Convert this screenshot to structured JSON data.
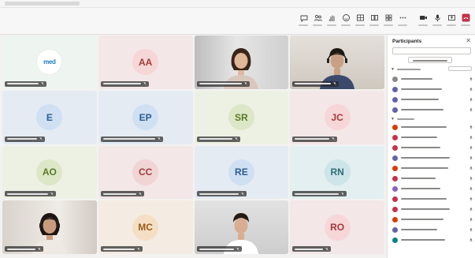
{
  "meeting": {
    "timer": ""
  },
  "toolbar": {
    "tools": [
      {
        "icon": "chat-icon"
      },
      {
        "icon": "people-icon"
      },
      {
        "icon": "raise-hand-icon"
      },
      {
        "icon": "reactions-icon"
      },
      {
        "icon": "view-icon"
      },
      {
        "icon": "rooms-icon"
      },
      {
        "icon": "apps-icon"
      },
      {
        "icon": "more-icon"
      },
      {
        "icon": "camera-icon"
      },
      {
        "icon": "mic-icon"
      },
      {
        "icon": "share-icon"
      }
    ],
    "leave_icon": "phone-hangup-icon"
  },
  "colors": {
    "accent": "#6264a7",
    "leave": "#c4314b",
    "nametag_bg": "#3b3a39"
  },
  "tiles": [
    {
      "kind": "logo",
      "initials": "",
      "logo_text": "med",
      "bg": "#eef4ef"
    },
    {
      "kind": "avatar",
      "initials": "AA",
      "bg": "#f3e7e7",
      "avatar_bg": "#f6d6d6",
      "avatar_fg": "#a33b3b"
    },
    {
      "kind": "video",
      "initials": "",
      "bg": "#cfcfcf"
    },
    {
      "kind": "video",
      "initials": "",
      "bg": "#d9d6d0"
    },
    {
      "kind": "avatar",
      "initials": "E",
      "bg": "#e5ebf3",
      "avatar_bg": "#cfe0f2",
      "avatar_fg": "#2b5c93"
    },
    {
      "kind": "avatar",
      "initials": "EP",
      "bg": "#e5ebf3",
      "avatar_bg": "#cfe0f2",
      "avatar_fg": "#2b5c93"
    },
    {
      "kind": "avatar",
      "initials": "SR",
      "bg": "#edf1e4",
      "avatar_bg": "#dbe7c7",
      "avatar_fg": "#5b7a26"
    },
    {
      "kind": "avatar",
      "initials": "JC",
      "bg": "#f3e7e7",
      "avatar_bg": "#f6d6d6",
      "avatar_fg": "#a33b3b"
    },
    {
      "kind": "avatar",
      "initials": "AO",
      "bg": "#edf1e4",
      "avatar_bg": "#dbe7c7",
      "avatar_fg": "#5b7a26"
    },
    {
      "kind": "avatar",
      "initials": "CC",
      "bg": "#f3e7e7",
      "avatar_bg": "#f1d4d4",
      "avatar_fg": "#a33b3b"
    },
    {
      "kind": "avatar",
      "initials": "RE",
      "bg": "#e5ebf3",
      "avatar_bg": "#cfe0f2",
      "avatar_fg": "#2b5c93"
    },
    {
      "kind": "avatar",
      "initials": "RN",
      "bg": "#e3eff0",
      "avatar_bg": "#cde5e8",
      "avatar_fg": "#2f6f78"
    },
    {
      "kind": "video",
      "initials": "",
      "bg": "#d8d3cd"
    },
    {
      "kind": "avatar",
      "initials": "MC",
      "bg": "#f4ece2",
      "avatar_bg": "#f4dfc4",
      "avatar_fg": "#9a5a1a"
    },
    {
      "kind": "video",
      "initials": "",
      "bg": "#d6d6d6"
    },
    {
      "kind": "avatar",
      "initials": "RO",
      "bg": "#f3e7e7",
      "avatar_bg": "#f6d6d6",
      "avatar_fg": "#a33b3b"
    }
  ],
  "panel": {
    "title": "Participants",
    "search_placeholder": "",
    "share_label": "",
    "rows": [
      {
        "color": "#8a8886"
      },
      {
        "color": "#6264a7"
      },
      {
        "color": "#6264a7"
      },
      {
        "color": "#6264a7"
      },
      {
        "color": "#d83b01"
      },
      {
        "color": "#c4314b"
      },
      {
        "color": "#c4314b"
      },
      {
        "color": "#6264a7"
      },
      {
        "color": "#d83b01"
      },
      {
        "color": "#c4314b"
      },
      {
        "color": "#8764b8"
      },
      {
        "color": "#c4314b"
      },
      {
        "color": "#c4314b"
      },
      {
        "color": "#d83b01"
      },
      {
        "color": "#6264a7"
      },
      {
        "color": "#038387"
      }
    ]
  }
}
